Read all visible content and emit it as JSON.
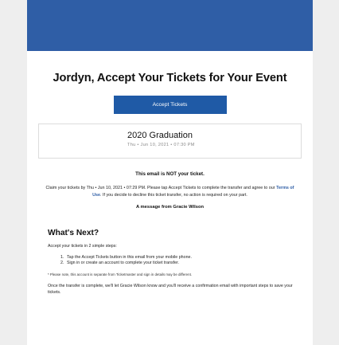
{
  "email": {
    "headline": "Jordyn, Accept Your Tickets for Your Event",
    "accept_button_label": "Accept Tickets",
    "event": {
      "name": "2020 Graduation",
      "date": "Thu • Jun 10, 2021 • 07:30 PM"
    },
    "not_ticket_notice": "This email is NOT your ticket.",
    "claim_text": {
      "before_link": "Claim your tickets by Thu • Jun 10, 2021 • 07:29 PM. Please tap Accept Tickets to complete the transfer and agree to our ",
      "link": "Terms of Use",
      "after_link": ". If you decide to decline this ticket transfer, no action is required on your part."
    },
    "message_from": "A message from Gracie Wilson",
    "whats_next_title": "What's Next?",
    "accept_intro": "Accept your tickets in 2 simple steps:",
    "steps": [
      {
        "num": "1.",
        "text": "Tap the Accept Tickets button in this email from your mobile phone."
      },
      {
        "num": "2.",
        "text": "Sign in or create an account to complete your ticket transfer."
      }
    ],
    "note": "* Please note, this account is separate from Ticketmaster and sign in details may be different.",
    "completion_text": "Once the transfer is complete, we'll let Gracie Wilson know and you'll receive a confirmation email with important steps to save your tickets."
  },
  "colors": {
    "banner": "#2f5ea6",
    "button": "#1f5aa6",
    "link": "#2f5ea6",
    "page_background": "#eeeeee"
  }
}
